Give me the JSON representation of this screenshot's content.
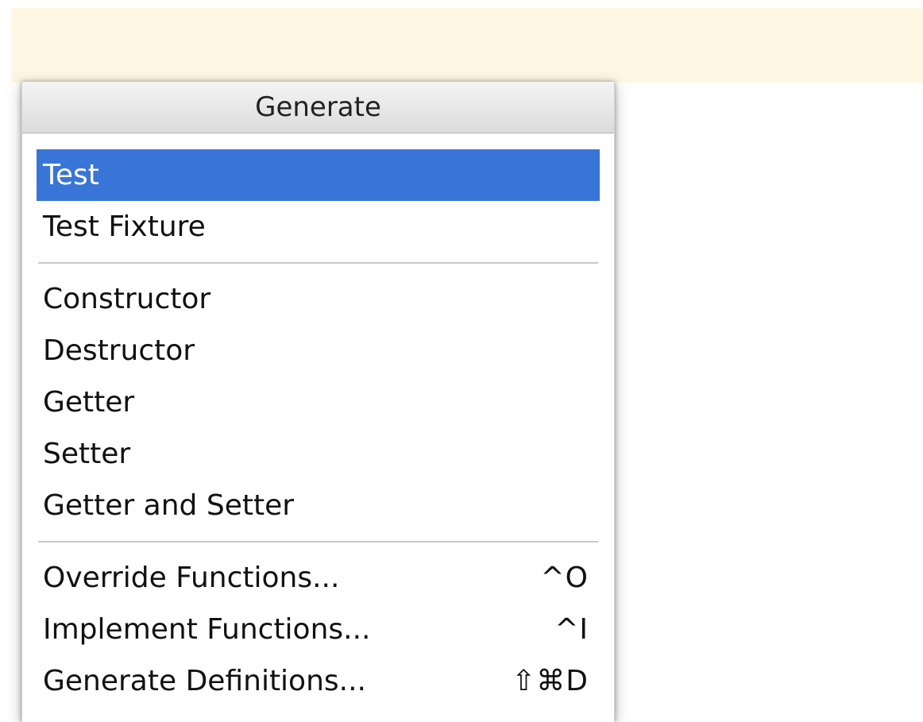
{
  "popup": {
    "title": "Generate"
  },
  "menu": {
    "group1": [
      {
        "label": "Test",
        "selected": true
      },
      {
        "label": "Test Fixture"
      }
    ],
    "group2": [
      {
        "label": "Constructor"
      },
      {
        "label": "Destructor"
      },
      {
        "label": "Getter"
      },
      {
        "label": "Setter"
      },
      {
        "label": "Getter and Setter"
      }
    ],
    "group3": [
      {
        "label": "Override Functions...",
        "shortcut": "^O"
      },
      {
        "label": "Implement Functions...",
        "shortcut": "^I"
      },
      {
        "label": "Generate Definitions...",
        "shortcut": "⇧⌘D"
      }
    ]
  },
  "colors": {
    "selection": "#3875d7",
    "editor_background": "#fdf6e3"
  }
}
